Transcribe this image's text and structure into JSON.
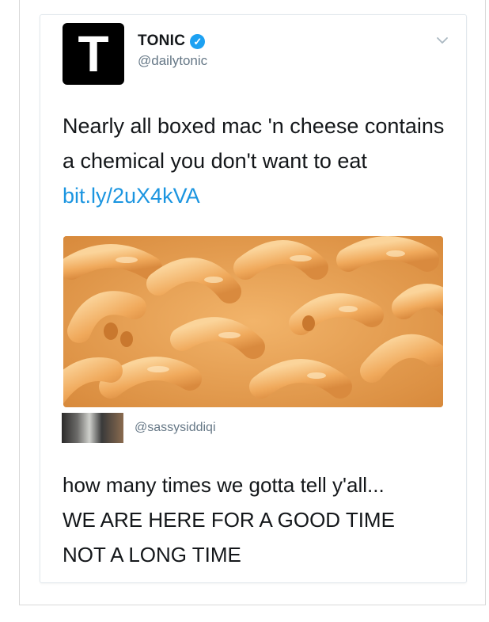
{
  "tweet": {
    "avatar_letter": "T",
    "name": "TONIC",
    "verified_icon": "verified-check-icon",
    "handle": "@dailytonic",
    "text": "Nearly all boxed mac 'n cheese contains a chemical you don't want to eat",
    "link": "bit.ly/2uX4kVA",
    "menu_icon": "chevron-down-icon",
    "media_description_icon": "mac-and-cheese-photo"
  },
  "reply": {
    "handle": "@sassysiddiqi",
    "line1": "how many times we gotta tell y'all...",
    "line2": "WE ARE HERE FOR A GOOD TIME",
    "line3": "NOT A LONG TIME"
  },
  "colors": {
    "link": "#1b95e0",
    "verified": "#1da1f2",
    "handle": "#657786",
    "text": "#14171a"
  }
}
